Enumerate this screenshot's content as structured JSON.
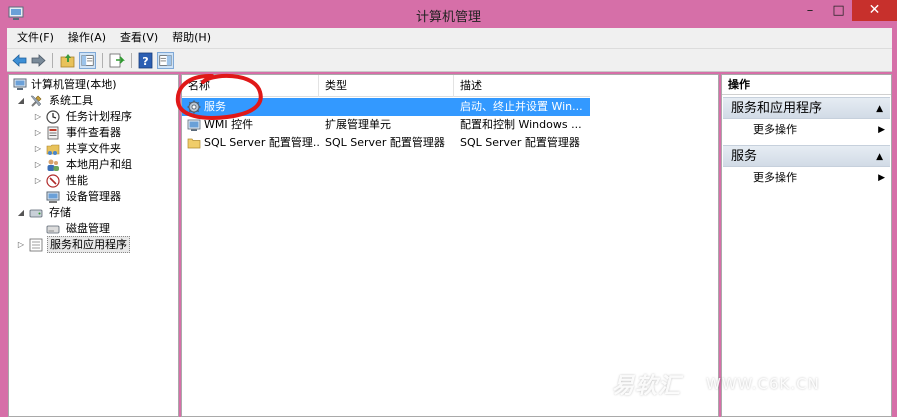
{
  "window": {
    "title": "计算机管理",
    "min_glyph": "–",
    "max_glyph": "□",
    "close_glyph": "✕"
  },
  "menu": [
    "文件(F)",
    "操作(A)",
    "查看(V)",
    "帮助(H)"
  ],
  "tree": {
    "root": "计算机管理(本地)",
    "system_tools": "系统工具",
    "task_scheduler": "任务计划程序",
    "event_viewer": "事件查看器",
    "shared_folders": "共享文件夹",
    "local_users": "本地用户和组",
    "performance": "性能",
    "device_manager": "设备管理器",
    "storage": "存储",
    "disk_management": "磁盘管理",
    "services_apps": "服务和应用程序"
  },
  "list": {
    "columns": [
      "名称",
      "类型",
      "描述"
    ],
    "rows": [
      {
        "name": "服务",
        "type": "",
        "desc": "启动、终止并设置 Win..."
      },
      {
        "name": "WMI 控件",
        "type": "扩展管理单元",
        "desc": "配置和控制 Windows ..."
      },
      {
        "name": "SQL Server 配置管理...",
        "type": "SQL Server 配置管理器",
        "desc": "SQL Server 配置管理器"
      }
    ]
  },
  "actions": {
    "header": "操作",
    "section1": "服务和应用程序",
    "section1_more": "更多操作",
    "section2": "服务",
    "section2_more": "更多操作"
  },
  "watermark": {
    "brand": "易软汇",
    "url": "WWW.C6K.CN"
  }
}
